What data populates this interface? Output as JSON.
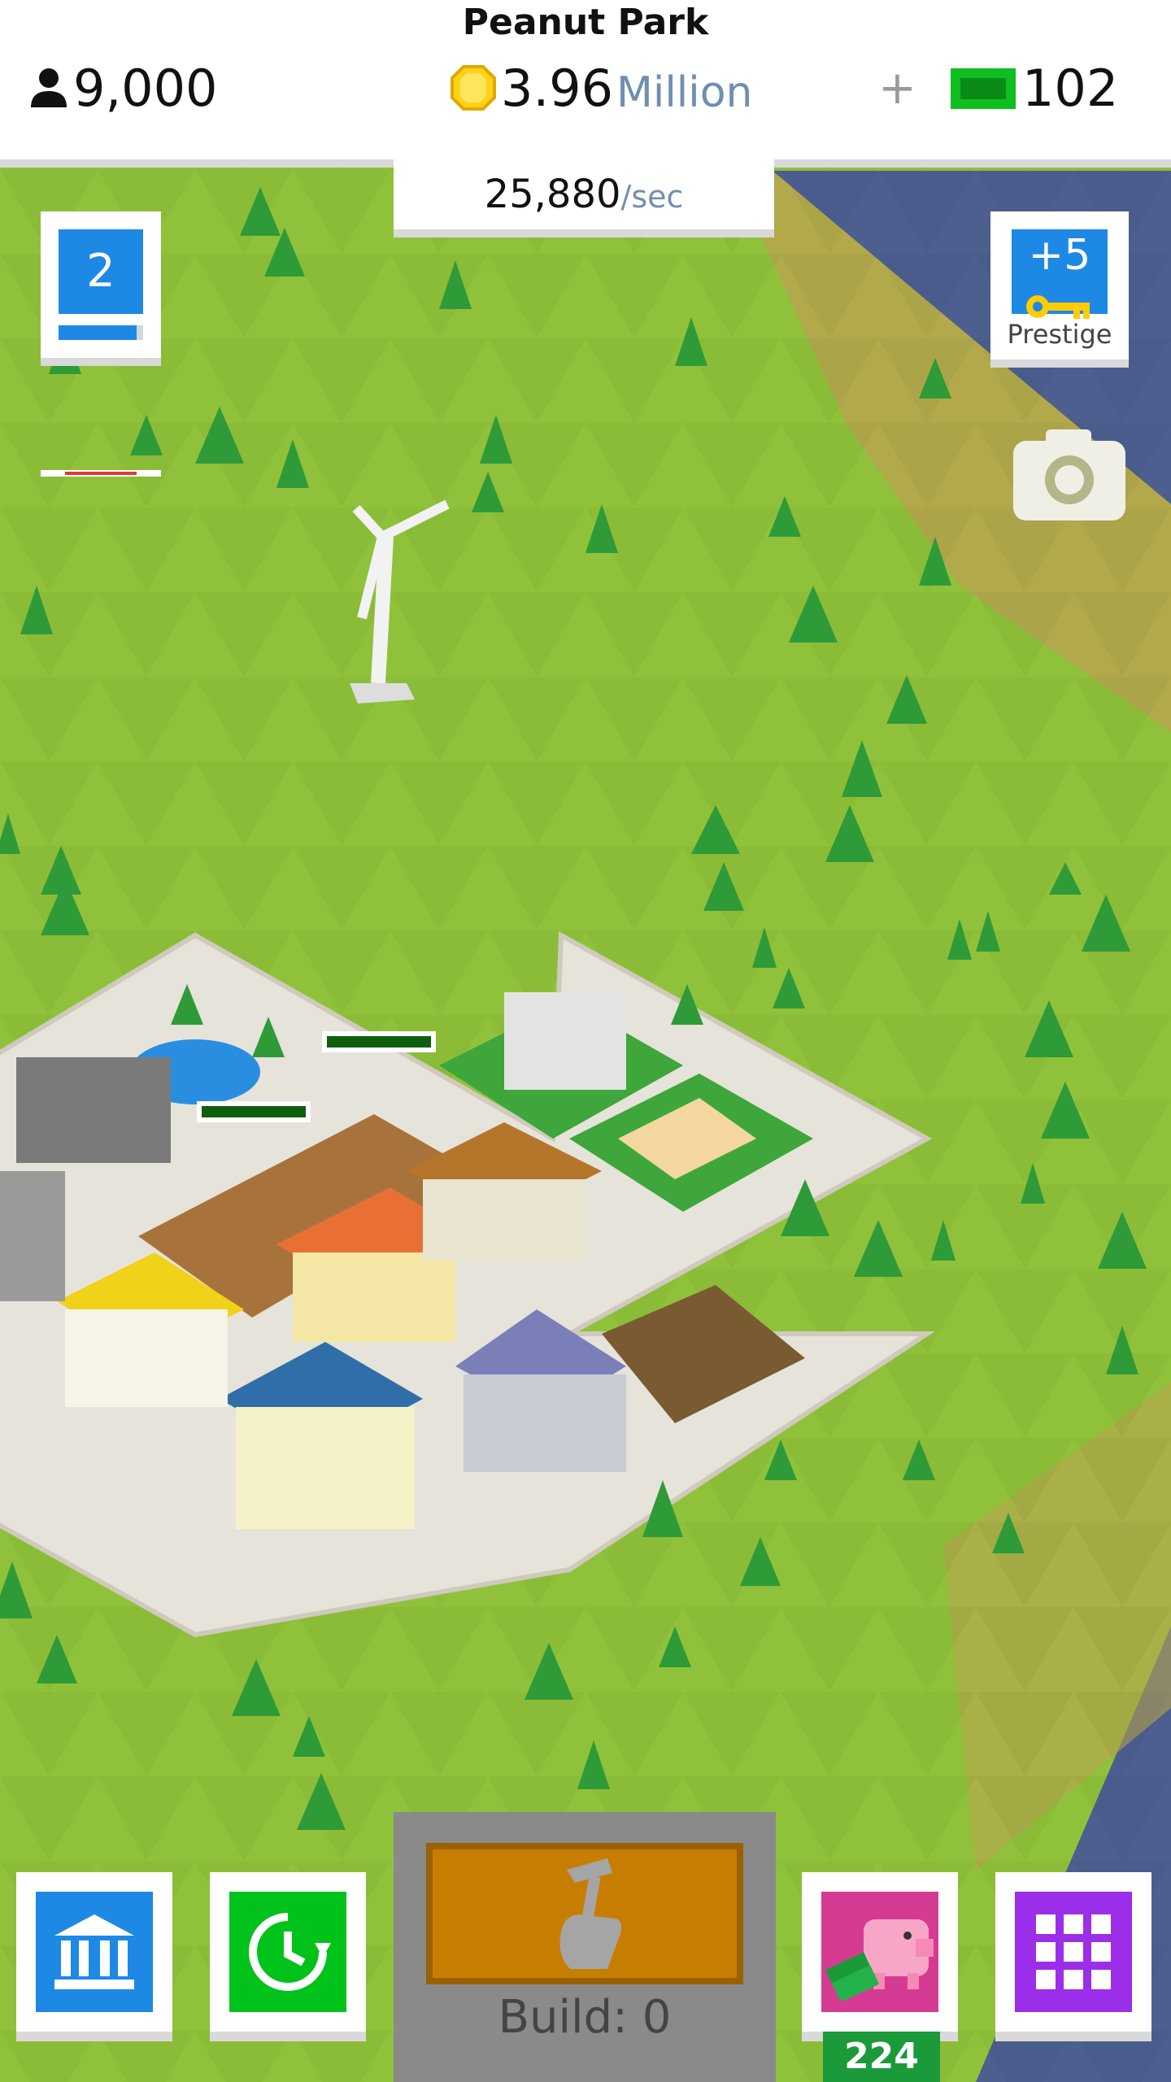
{
  "header": {
    "city_name": "Peanut Park",
    "population": "9,000",
    "money_value": "3.96",
    "money_unit": "Million",
    "plus_label": "+",
    "gems": "102",
    "income_rate": "25,880",
    "income_unit": "/sec"
  },
  "level": {
    "value": "2",
    "progress": 0.92
  },
  "prestige": {
    "value": "+5",
    "label": "Prestige"
  },
  "build": {
    "label": "Build: 0"
  },
  "shop": {
    "badge": "224"
  },
  "colors": {
    "accent_blue": "#1e88e5",
    "green_button": "#00c21a",
    "purple_button": "#9b2ee8",
    "pink_button": "#d63b93",
    "gem_green": "#0fbf1f",
    "build_orange": "#c77e00",
    "water": "#4c5f8f"
  }
}
